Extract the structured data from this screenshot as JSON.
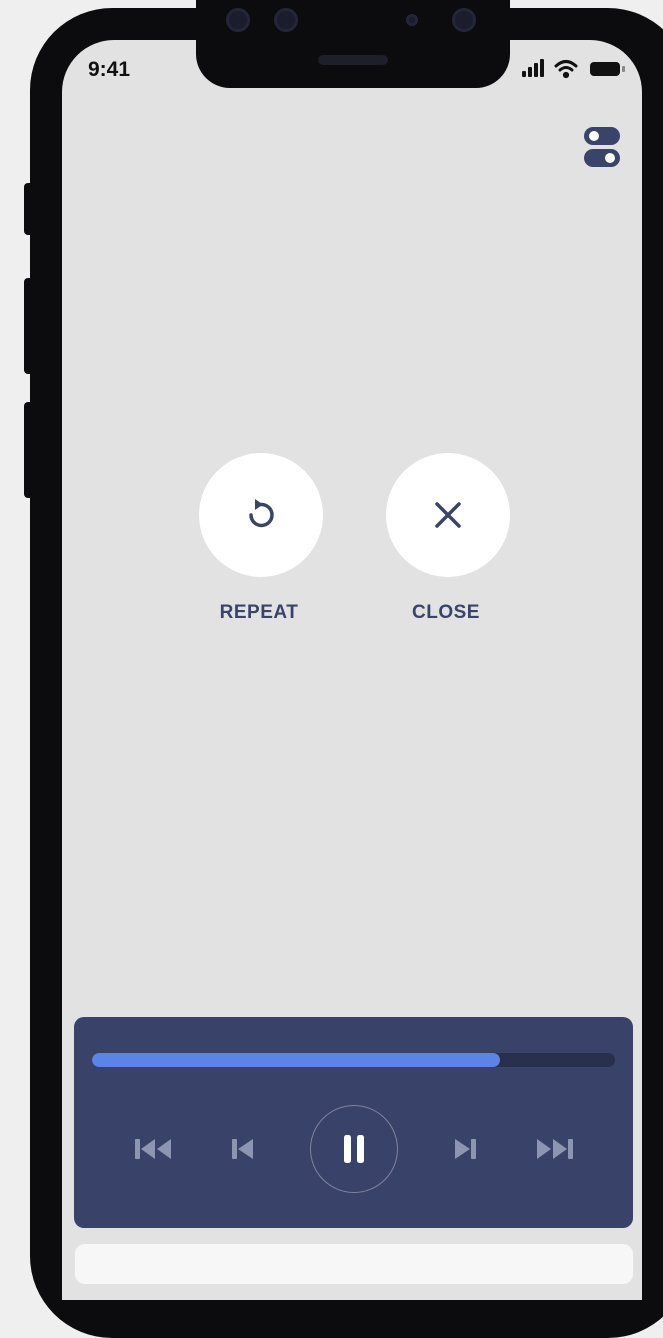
{
  "status_bar": {
    "time": "9:41",
    "signal_icon": "signal-bars-icon",
    "wifi_icon": "wifi-icon",
    "battery_icon": "battery-icon"
  },
  "top_bar": {
    "settings_icon": "toggle-switches-icon"
  },
  "actions": {
    "repeat": {
      "label": "REPEAT",
      "icon": "repeat-icon"
    },
    "close": {
      "label": "CLOSE",
      "icon": "close-icon"
    }
  },
  "player": {
    "progress_percent": 78,
    "controls": [
      "fast-rewind-icon",
      "skip-previous-icon",
      "pause-icon",
      "skip-next-icon",
      "fast-forward-icon"
    ]
  },
  "colors": {
    "screen_background": "#e2e2e2",
    "accent_navy": "#394369",
    "label_color": "#3a4469",
    "progress_fill": "#5c84e6",
    "progress_track": "#29304d"
  }
}
